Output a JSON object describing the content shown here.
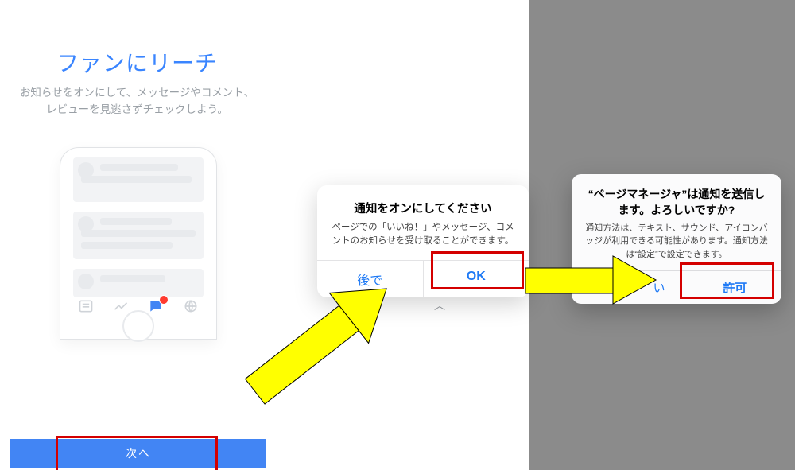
{
  "onboard": {
    "title": "ファンにリーチ",
    "subtitle": "お知らせをオンにして、メッセージやコメント、レビューを見逃さずチェックしよう。",
    "next": "次へ"
  },
  "alert1": {
    "title": "通知をオンにしてください",
    "body": "ページでの「いいね！」やメッセージ、コメントのお知らせを受け取ることができます。",
    "later": "後で",
    "ok": "OK"
  },
  "alert2": {
    "title": "“ページマネージャ”は通知を送信します。よろしいですか?",
    "body": "通知方法は、テキスト、サウンド、アイコンバッジが利用できる可能性があります。通知方法は“設定”で設定できます。",
    "deny_tail": "い",
    "allow": "許可"
  },
  "colors": {
    "accent": "#4285f4",
    "annotation": "#d40000",
    "arrow": "#ffff00"
  }
}
